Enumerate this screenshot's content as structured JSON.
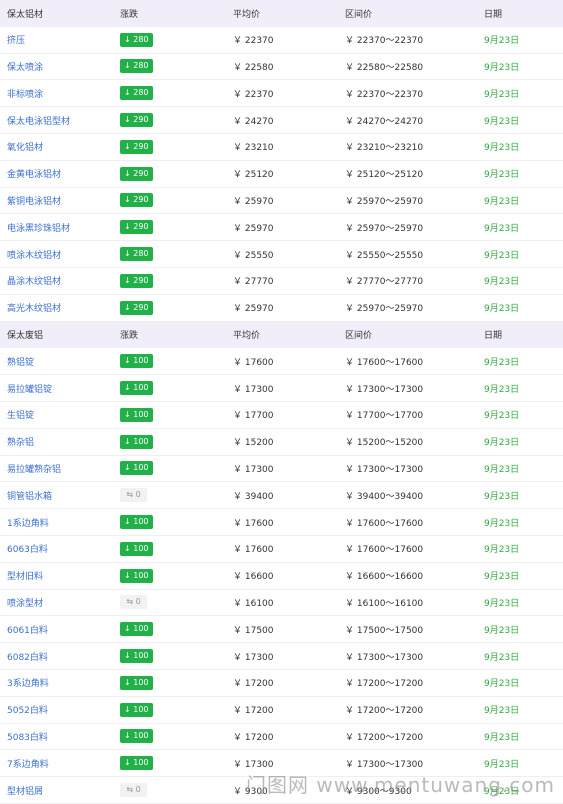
{
  "sections": [
    {
      "headers": [
        "保太铝材",
        "涨跌",
        "平均价",
        "区间价",
        "日期"
      ],
      "rows": [
        {
          "name": "挤压",
          "change": "↓ 280",
          "change_type": "down",
          "avg": "￥ 22370",
          "range": "￥ 22370～22370",
          "date": "9月23日"
        },
        {
          "name": "保太喷涂",
          "change": "↓ 280",
          "change_type": "down",
          "avg": "￥ 22580",
          "range": "￥ 22580～22580",
          "date": "9月23日"
        },
        {
          "name": "非标喷涂",
          "change": "↓ 280",
          "change_type": "down",
          "avg": "￥ 22370",
          "range": "￥ 22370～22370",
          "date": "9月23日"
        },
        {
          "name": "保太电泳铝型材",
          "change": "↓ 290",
          "change_type": "down",
          "avg": "￥ 24270",
          "range": "￥ 24270～24270",
          "date": "9月23日"
        },
        {
          "name": "氧化铝材",
          "change": "↓ 290",
          "change_type": "down",
          "avg": "￥ 23210",
          "range": "￥ 23210～23210",
          "date": "9月23日"
        },
        {
          "name": "金黄电泳铝材",
          "change": "↓ 290",
          "change_type": "down",
          "avg": "￥ 25120",
          "range": "￥ 25120～25120",
          "date": "9月23日"
        },
        {
          "name": "紫铜电泳铝材",
          "change": "↓ 290",
          "change_type": "down",
          "avg": "￥ 25970",
          "range": "￥ 25970～25970",
          "date": "9月23日"
        },
        {
          "name": "电泳黑珍珠铝材",
          "change": "↓ 290",
          "change_type": "down",
          "avg": "￥ 25970",
          "range": "￥ 25970～25970",
          "date": "9月23日"
        },
        {
          "name": "喷涂木纹铝材",
          "change": "↓ 280",
          "change_type": "down",
          "avg": "￥ 25550",
          "range": "￥ 25550～25550",
          "date": "9月23日"
        },
        {
          "name": "晶涂木纹铝材",
          "change": "↓ 290",
          "change_type": "down",
          "avg": "￥ 27770",
          "range": "￥ 27770～27770",
          "date": "9月23日"
        },
        {
          "name": "高光木纹铝材",
          "change": "↓ 290",
          "change_type": "down",
          "avg": "￥ 25970",
          "range": "￥ 25970～25970",
          "date": "9月23日"
        }
      ]
    },
    {
      "headers": [
        "保太废铝",
        "涨跌",
        "平均价",
        "区间价",
        "日期"
      ],
      "rows": [
        {
          "name": "熟铝锭",
          "change": "↓ 100",
          "change_type": "down",
          "avg": "￥ 17600",
          "range": "￥ 17600～17600",
          "date": "9月23日"
        },
        {
          "name": "易拉罐铝锭",
          "change": "↓ 100",
          "change_type": "down",
          "avg": "￥ 17300",
          "range": "￥ 17300～17300",
          "date": "9月23日"
        },
        {
          "name": "生铝锭",
          "change": "↓ 100",
          "change_type": "down",
          "avg": "￥ 17700",
          "range": "￥ 17700～17700",
          "date": "9月23日"
        },
        {
          "name": "熟杂铝",
          "change": "↓ 100",
          "change_type": "down",
          "avg": "￥ 15200",
          "range": "￥ 15200～15200",
          "date": "9月23日"
        },
        {
          "name": "易拉罐熟杂铝",
          "change": "↓ 100",
          "change_type": "down",
          "avg": "￥ 17300",
          "range": "￥ 17300～17300",
          "date": "9月23日"
        },
        {
          "name": "铜管铝水箱",
          "change": "⇆ 0",
          "change_type": "flat",
          "avg": "￥ 39400",
          "range": "￥ 39400～39400",
          "date": "9月23日"
        },
        {
          "name": "1系边角料",
          "change": "↓ 100",
          "change_type": "down",
          "avg": "￥ 17600",
          "range": "￥ 17600～17600",
          "date": "9月23日"
        },
        {
          "name": "6063白料",
          "change": "↓ 100",
          "change_type": "down",
          "avg": "￥ 17600",
          "range": "￥ 17600～17600",
          "date": "9月23日"
        },
        {
          "name": "型材旧料",
          "change": "↓ 100",
          "change_type": "down",
          "avg": "￥ 16600",
          "range": "￥ 16600～16600",
          "date": "9月23日"
        },
        {
          "name": "喷涂型材",
          "change": "⇆ 0",
          "change_type": "flat",
          "avg": "￥ 16100",
          "range": "￥ 16100～16100",
          "date": "9月23日"
        },
        {
          "name": "6061白料",
          "change": "↓ 100",
          "change_type": "down",
          "avg": "￥ 17500",
          "range": "￥ 17500～17500",
          "date": "9月23日"
        },
        {
          "name": "6082白料",
          "change": "↓ 100",
          "change_type": "down",
          "avg": "￥ 17300",
          "range": "￥ 17300～17300",
          "date": "9月23日"
        },
        {
          "name": "3系边角料",
          "change": "↓ 100",
          "change_type": "down",
          "avg": "￥ 17200",
          "range": "￥ 17200～17200",
          "date": "9月23日"
        },
        {
          "name": "5052白料",
          "change": "↓ 100",
          "change_type": "down",
          "avg": "￥ 17200",
          "range": "￥ 17200～17200",
          "date": "9月23日"
        },
        {
          "name": "5083白料",
          "change": "↓ 100",
          "change_type": "down",
          "avg": "￥ 17200",
          "range": "￥ 17200～17200",
          "date": "9月23日"
        },
        {
          "name": "7系边角料",
          "change": "↓ 100",
          "change_type": "down",
          "avg": "￥ 17300",
          "range": "￥ 17300～17300",
          "date": "9月23日"
        },
        {
          "name": "型材铝屑",
          "change": "⇆ 0",
          "change_type": "flat",
          "avg": "￥ 9300",
          "range": "￥ 9300～9300",
          "date": "9月23日"
        }
      ]
    }
  ],
  "watermark": "门图网 www.mentuwang.com",
  "colors": {
    "header_bg": "#f1eef9",
    "link": "#3b6fd0",
    "down_badge": "#22b048",
    "flat_badge": "#f2f2f2",
    "date": "#2fa83e"
  }
}
